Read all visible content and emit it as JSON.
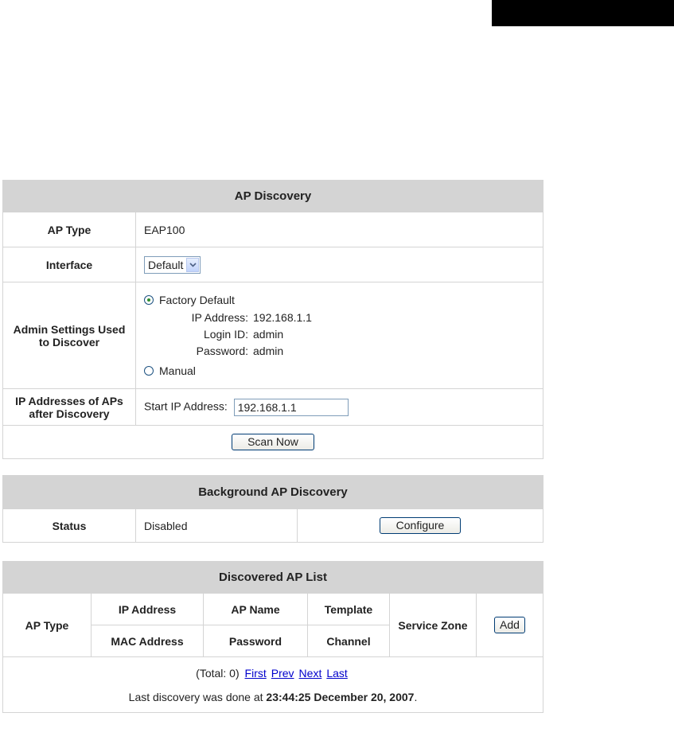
{
  "ap_discovery": {
    "title": "AP Discovery",
    "ap_type_label": "AP Type",
    "ap_type_value": "EAP100",
    "interface_label": "Interface",
    "interface_value": "Default",
    "admin_label_line1": "Admin Settings Used",
    "admin_label_line2": "to Discover",
    "factory_default_label": "Factory Default",
    "ip_address_key": "IP Address:",
    "ip_address_value": "192.168.1.1",
    "login_id_key": "Login ID:",
    "login_id_value": "admin",
    "password_key": "Password:",
    "password_value": "admin",
    "manual_label": "Manual",
    "ip_after_label_line1": "IP Addresses of APs",
    "ip_after_label_line2": "after Discovery",
    "start_ip_label": "Start IP Address:",
    "start_ip_value": "192.168.1.1",
    "scan_button": "Scan Now"
  },
  "background_discovery": {
    "title": "Background AP Discovery",
    "status_label": "Status",
    "status_value": "Disabled",
    "configure_button": "Configure"
  },
  "discovered_list": {
    "title": "Discovered AP List",
    "col_ap_type": "AP Type",
    "col_ip_address": "IP Address",
    "col_mac_address": "MAC Address",
    "col_ap_name": "AP Name",
    "col_password": "Password",
    "col_template": "Template",
    "col_channel": "Channel",
    "col_service_zone": "Service Zone",
    "add_button": "Add",
    "total_text": "(Total: 0)",
    "first_link": "First",
    "prev_link": "Prev",
    "next_link": "Next",
    "last_link": "Last",
    "last_discovery_prefix": "Last discovery was done at",
    "last_discovery_time": "23:44:25 December 20, 2007",
    "last_discovery_suffix": "."
  }
}
